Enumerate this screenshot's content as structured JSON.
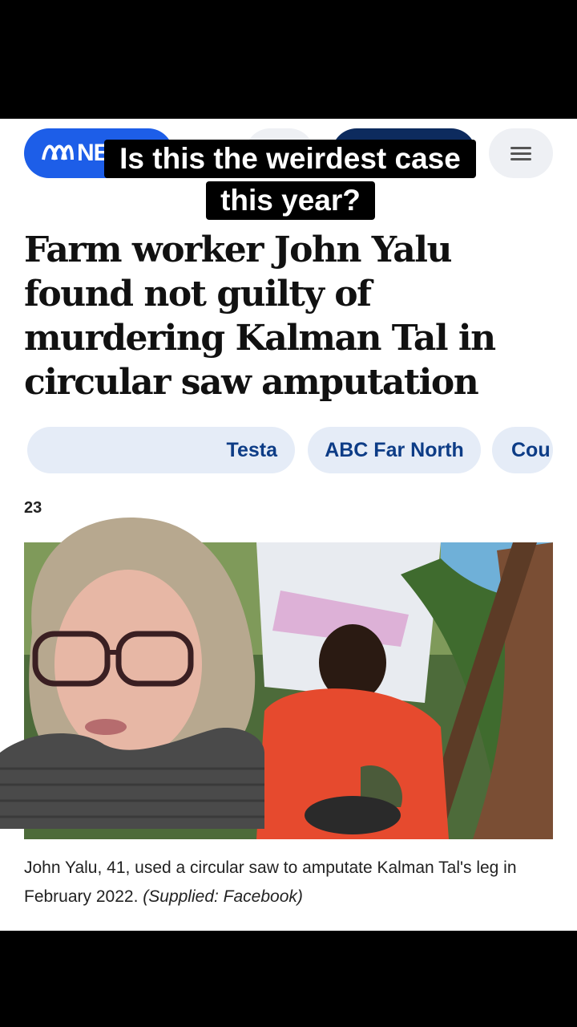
{
  "header": {
    "logo_text": "NE",
    "logo_icon": "abc-logo-icon",
    "menu_icon": "hamburger-menu-icon",
    "colors": {
      "logo_blue": "#1d5ee8",
      "navy": "#0d2b5e",
      "pill_grey": "#eef0f4"
    }
  },
  "overlay_caption": {
    "line1": "Is this the weirdest case",
    "line2": "this year?"
  },
  "article": {
    "headline": "Farm worker John Yalu found not guilty of murdering Kalman Tal in circular saw amputation",
    "tags": [
      "Testa",
      "ABC Far North",
      "Cou"
    ],
    "date_fragment": "23",
    "photo_caption": "John Yalu, 41, used a circular saw to amputate Kalman Tal's leg in February 2022.",
    "photo_credit": "(Supplied: Facebook)"
  },
  "colors": {
    "tag_bg": "#e5ecf7",
    "tag_text": "#0d3c86"
  }
}
